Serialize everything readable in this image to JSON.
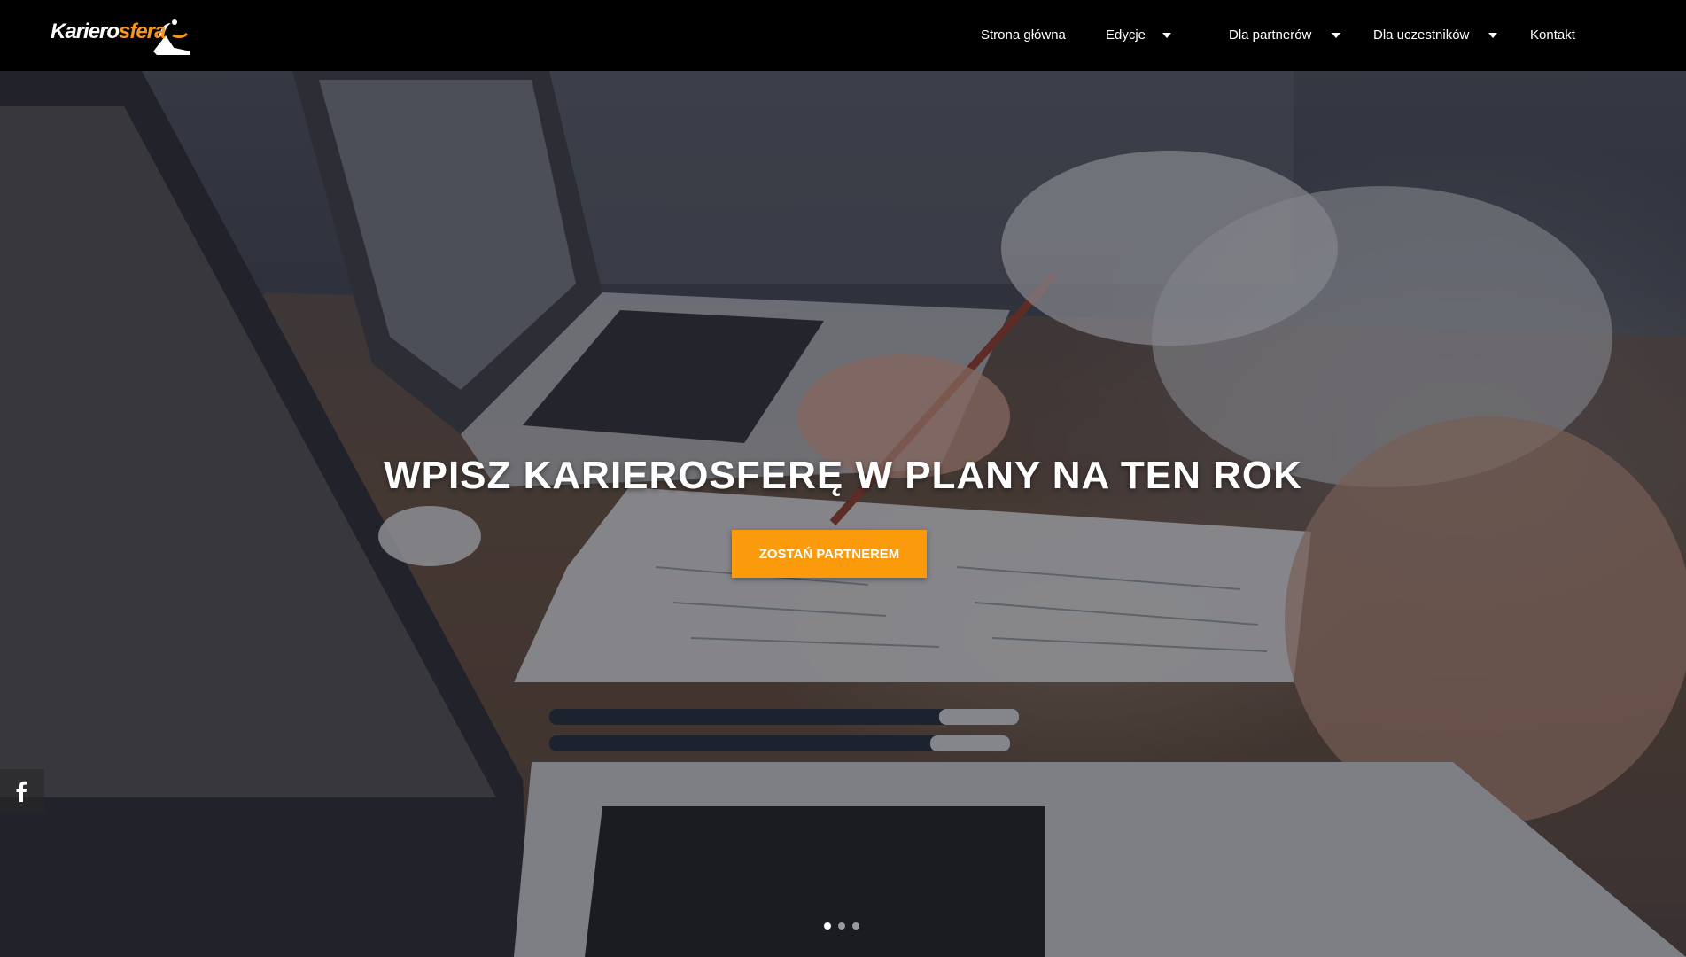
{
  "brand": {
    "logo_text_main": "Kariero",
    "logo_text_accent": "sfera",
    "accent_color": "#f7941d"
  },
  "nav": {
    "items": [
      {
        "label": "Strona główna",
        "has_dropdown": false
      },
      {
        "label": "Edycje",
        "has_dropdown": true
      },
      {
        "label": "Dla partnerów",
        "has_dropdown": true
      },
      {
        "label": "Dla uczestników",
        "has_dropdown": true
      },
      {
        "label": "Kontakt",
        "has_dropdown": false
      }
    ],
    "dropdown_icon": "caret-down-icon"
  },
  "hero": {
    "headline": "WPISZ KARIEROSFERĘ W PLANY NA TEN ROK",
    "cta_label": "ZOSTAŃ PARTNEREM",
    "cta_color": "#fb9a0b",
    "background_image": "laptops-and-documents-on-desk-photo"
  },
  "social": {
    "facebook_icon": "facebook-icon"
  },
  "slider": {
    "slide_count": 3,
    "active_slide": 1,
    "active_color": "#ffffff",
    "inactive_color": "#9a9a9a"
  }
}
